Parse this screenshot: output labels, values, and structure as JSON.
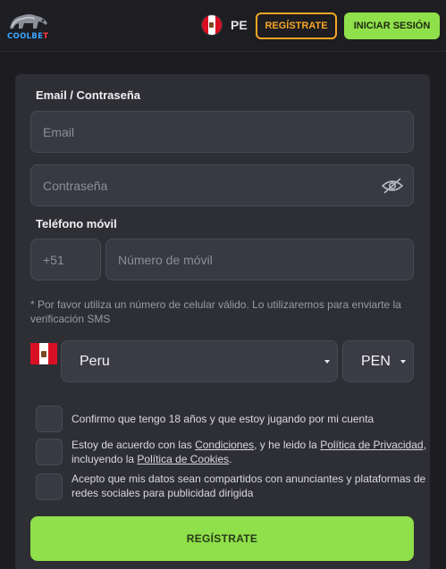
{
  "header": {
    "logo_text_a": "COOLBE",
    "logo_text_b": "T",
    "country_code": "PE",
    "register_label": "REGÍSTRATE",
    "login_label": "INICIAR SESIÓN",
    "colors": {
      "register": "#f5a623",
      "login": "#8fe04a"
    }
  },
  "form": {
    "email_section_label": "Email / Contraseña",
    "email_placeholder": "Email",
    "password_placeholder": "Contraseña",
    "phone_section_label": "Teléfono móvil",
    "phone_prefix": "+51",
    "phone_placeholder": "Número de móvil",
    "phone_hint": "* Por favor utiliza un número de celular válido. Lo utilizaremos para enviarte la verificación SMS",
    "country_value": "Peru",
    "currency_value": "PEN",
    "checkbox_age": "Confirmo que tengo 18 años y que estoy jugando por mi cuenta",
    "checkbox_terms": {
      "t1": "Estoy de acuerdo con las ",
      "l1": "Condiciones",
      "t2": ", y he leido la ",
      "l2": "Política de Privacidad",
      "t3": ", incluyendo la ",
      "l3": "Política de Cookies",
      "t4": "."
    },
    "checkbox_marketing": "Acepto que mis datos sean compartidos con anunciantes y plataformas de redes sociales para publicidad dirigida",
    "submit_label": "REGÍSTRATE",
    "colors": {
      "submit": "#8fe04a",
      "panel": "#2e2e35"
    }
  },
  "icons": {
    "logo": "coolbet-logo",
    "flag": "peru-flag-icon",
    "eye": "eye-slash-icon",
    "caret": "caret-down-icon"
  }
}
